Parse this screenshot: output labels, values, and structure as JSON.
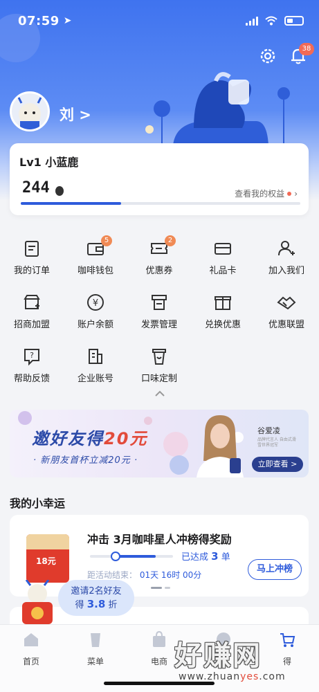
{
  "status_bar": {
    "time": "07:59"
  },
  "header": {
    "notification_count": "38",
    "username": "刘 >"
  },
  "member": {
    "level": "Lv1 小蓝鹿",
    "beans": "244",
    "rights_link": "查看我的权益",
    "progress": 0.36
  },
  "grid": [
    {
      "label": "我的订单",
      "icon": "order-icon"
    },
    {
      "label": "咖啡钱包",
      "icon": "wallet-icon",
      "badge": "5"
    },
    {
      "label": "优惠券",
      "icon": "coupon-icon",
      "badge": "2"
    },
    {
      "label": "礼品卡",
      "icon": "gift-card-icon"
    },
    {
      "label": "加入我们",
      "icon": "add-user-icon"
    },
    {
      "label": "招商加盟",
      "icon": "franchise-icon"
    },
    {
      "label": "账户余额",
      "icon": "yen-icon"
    },
    {
      "label": "发票管理",
      "icon": "invoice-icon"
    },
    {
      "label": "兑换优惠",
      "icon": "redeem-icon"
    },
    {
      "label": "优惠联盟",
      "icon": "alliance-icon"
    },
    {
      "label": "帮助反馈",
      "icon": "help-icon"
    },
    {
      "label": "企业账号",
      "icon": "enterprise-icon"
    },
    {
      "label": "口味定制",
      "icon": "cup-icon"
    }
  ],
  "banner": {
    "headline_prefix": "邀好友得",
    "headline_amount": "20元",
    "subline": "· 新朋友首杯立减20元 ·",
    "brand": "谷爱凌",
    "brand_note": "品牌代言人 自由式滑雪世界冠军",
    "cta": "立即查看 >"
  },
  "lucky": {
    "section_title": "我的小幸运",
    "title": "冲击 3月咖啡星人冲榜得奖励",
    "done_prefix": "已达成",
    "done_count": "3",
    "done_suffix": "单",
    "time_label": "距活动结束：",
    "time_value": "01天 16时 00分",
    "button": "马上冲榜",
    "redpack_amount": "18元",
    "progress": 0.7
  },
  "invite": {
    "line1_prefix": "邀请2名好友",
    "line2_prefix": "得",
    "line2_value": "3.8",
    "line2_suffix": "折"
  },
  "tabs": [
    {
      "label": "首页",
      "icon": "home-icon"
    },
    {
      "label": "菜单",
      "icon": "menu-cup-icon"
    },
    {
      "label": "电商",
      "icon": "shopping-bag-icon"
    },
    {
      "label": "会",
      "icon": "member-icon"
    },
    {
      "label": "得",
      "icon": "cart-icon"
    }
  ],
  "watermark": {
    "text": "好赚网",
    "url_prefix": "www.zhuan",
    "url_accent": "yes",
    "url_suffix": ".com"
  },
  "colors": {
    "primary": "#2e5bdb",
    "accent_red": "#f26a56",
    "header_blue": "#3f73ef"
  }
}
